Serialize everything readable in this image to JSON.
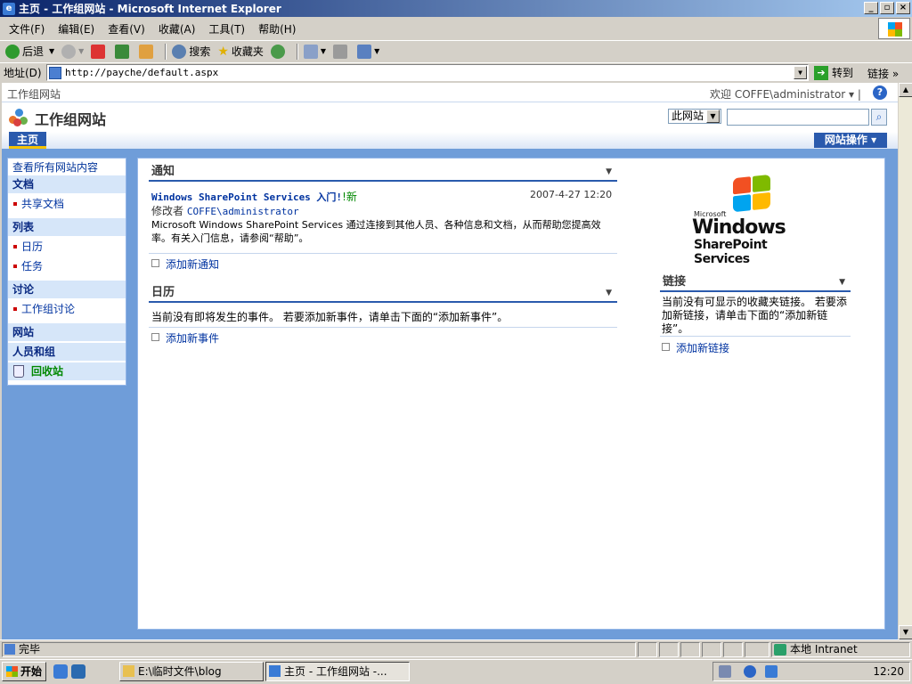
{
  "window": {
    "title": "主页 - 工作组网站 - Microsoft Internet Explorer"
  },
  "menu": [
    "文件(F)",
    "编辑(E)",
    "查看(V)",
    "收藏(A)",
    "工具(T)",
    "帮助(H)"
  ],
  "toolbar": {
    "back": "后退",
    "search": "搜索",
    "favorites": "收藏夹"
  },
  "address": {
    "label": "地址(D)",
    "url": "http://payche/default.aspx",
    "go": "转到",
    "links": "链接"
  },
  "site": {
    "breadcrumb": "工作组网站",
    "welcome": "欢迎 COFFE\\administrator ▾ |",
    "title": "工作组网站",
    "search_scope": "此网站",
    "home_tab": "主页",
    "site_actions": "网站操作 ▾"
  },
  "quicklaunch": {
    "view_all": "查看所有网站内容",
    "documents": "文档",
    "shared_docs": "共享文档",
    "lists": "列表",
    "calendar": "日历",
    "tasks": "任务",
    "discussions": "讨论",
    "team_discussion": "工作组讨论",
    "sites": "网站",
    "people": "人员和组",
    "recycle": "回收站"
  },
  "announcements": {
    "title": "通知",
    "item_title": "Windows SharePoint Services 入门!",
    "new_tag": "新",
    "date": "2007-4-27 12:20",
    "modified_label": "修改者",
    "modified_by": "COFFE\\administrator",
    "body": "Microsoft Windows SharePoint Services 通过连接到其他人员、各种信息和文档，从而帮助您提高效率。有关入门信息，请参阅“帮助”。",
    "add": "添加新通知"
  },
  "calendar": {
    "title": "日历",
    "empty": "当前没有即将发生的事件。 若要添加新事件，请单击下面的“添加新事件”。",
    "add": "添加新事件"
  },
  "logo": {
    "small": "Microsoft",
    "big": "Windows",
    "sub": "SharePoint Services"
  },
  "links_part": {
    "title": "链接",
    "empty": "当前没有可显示的收藏夹链接。 若要添加新链接，请单击下面的“添加新链接”。",
    "add": "添加新链接"
  },
  "statusbar": {
    "text": "完毕",
    "zone": "本地 Intranet"
  },
  "taskbar": {
    "start": "开始",
    "task1": "E:\\临时文件\\blog",
    "task2": "主页 - 工作组网站 -...",
    "clock": "12:20"
  }
}
